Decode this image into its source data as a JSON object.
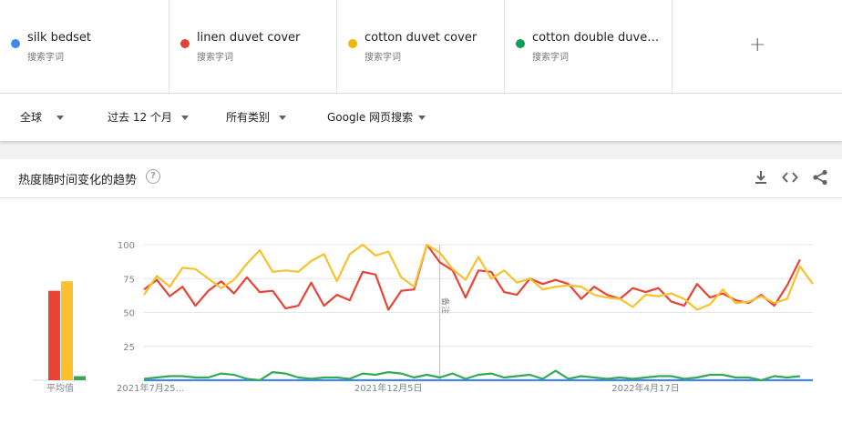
{
  "terms": [
    {
      "name": "silk bedset",
      "type": "搜索字词",
      "color": "#4285f4"
    },
    {
      "name": "linen duvet cover",
      "type": "搜索字词",
      "color": "#db4437"
    },
    {
      "name": "cotton duvet cover",
      "type": "搜索字词",
      "color": "#f4b400"
    },
    {
      "name": "cotton double duve…",
      "type": "搜索字词",
      "color": "#0f9d58"
    }
  ],
  "add_label": "+",
  "filters": {
    "region": "全球",
    "time": "过去 12 个月",
    "category": "所有类别",
    "search_type": "Google 网页搜索"
  },
  "card": {
    "title": "热度随时间变化的趋势",
    "help": "?"
  },
  "chart_data": {
    "type": "line",
    "ylim": [
      0,
      100
    ],
    "yticks": [
      25,
      50,
      75,
      100
    ],
    "xtick_labels": [
      "2021年7月25…",
      "2021年12月5日",
      "2022年4月17日"
    ],
    "xtick_index": [
      0,
      19,
      39
    ],
    "note_index": 23,
    "note_label": "备注",
    "average_label": "平均值",
    "averages": [
      {
        "name": "silk bedset",
        "value": 0,
        "color": "#4285f4"
      },
      {
        "name": "linen duvet cover",
        "value": 66,
        "color": "#ea4335"
      },
      {
        "name": "cotton duvet cover",
        "value": 73,
        "color": "#fbc02d"
      },
      {
        "name": "cotton double duve…",
        "value": 3,
        "color": "#34a853"
      }
    ],
    "series": [
      {
        "name": "silk bedset",
        "color": "#4285f4",
        "values": [
          0,
          0,
          0,
          0,
          0,
          0,
          0,
          0,
          0,
          0,
          0,
          0,
          0,
          0,
          0,
          0,
          0,
          0,
          0,
          0,
          0,
          0,
          0,
          0,
          0,
          0,
          0,
          0,
          0,
          0,
          0,
          0,
          0,
          0,
          0,
          0,
          0,
          0,
          0,
          0,
          0,
          0,
          0,
          0,
          0,
          0,
          0,
          0,
          0,
          0,
          0,
          0,
          0
        ]
      },
      {
        "name": "linen duvet cover",
        "color": "#ea4335",
        "values": [
          67,
          74,
          62,
          69,
          55,
          66,
          73,
          64,
          76,
          65,
          66,
          53,
          55,
          72,
          55,
          63,
          59,
          80,
          78,
          52,
          66,
          67,
          100,
          87,
          81,
          61,
          81,
          80,
          65,
          63,
          75,
          71,
          74,
          71,
          60,
          69,
          63,
          60,
          68,
          65,
          68,
          58,
          55,
          71,
          61,
          64,
          59,
          57,
          63,
          55,
          70,
          89
        ]
      },
      {
        "name": "cotton duvet cover",
        "color": "#fbc02d",
        "values": [
          63,
          77,
          69,
          83,
          82,
          75,
          68,
          74,
          86,
          96,
          80,
          81,
          80,
          88,
          93,
          73,
          93,
          100,
          92,
          95,
          76,
          69,
          100,
          94,
          82,
          74,
          91,
          75,
          81,
          72,
          75,
          67,
          69,
          70,
          69,
          63,
          61,
          60,
          54,
          63,
          62,
          64,
          60,
          52,
          56,
          67,
          57,
          58,
          62,
          57,
          60,
          84,
          71
        ]
      },
      {
        "name": "cotton double duve…",
        "color": "#34a853",
        "values": [
          1,
          2,
          3,
          3,
          2,
          2,
          5,
          4,
          1,
          0,
          6,
          5,
          2,
          1,
          2,
          2,
          1,
          5,
          4,
          6,
          5,
          2,
          4,
          2,
          5,
          1,
          4,
          5,
          2,
          3,
          4,
          1,
          7,
          1,
          3,
          2,
          1,
          2,
          1,
          2,
          3,
          3,
          1,
          2,
          4,
          4,
          2,
          2,
          0,
          3,
          2,
          3
        ]
      }
    ]
  }
}
